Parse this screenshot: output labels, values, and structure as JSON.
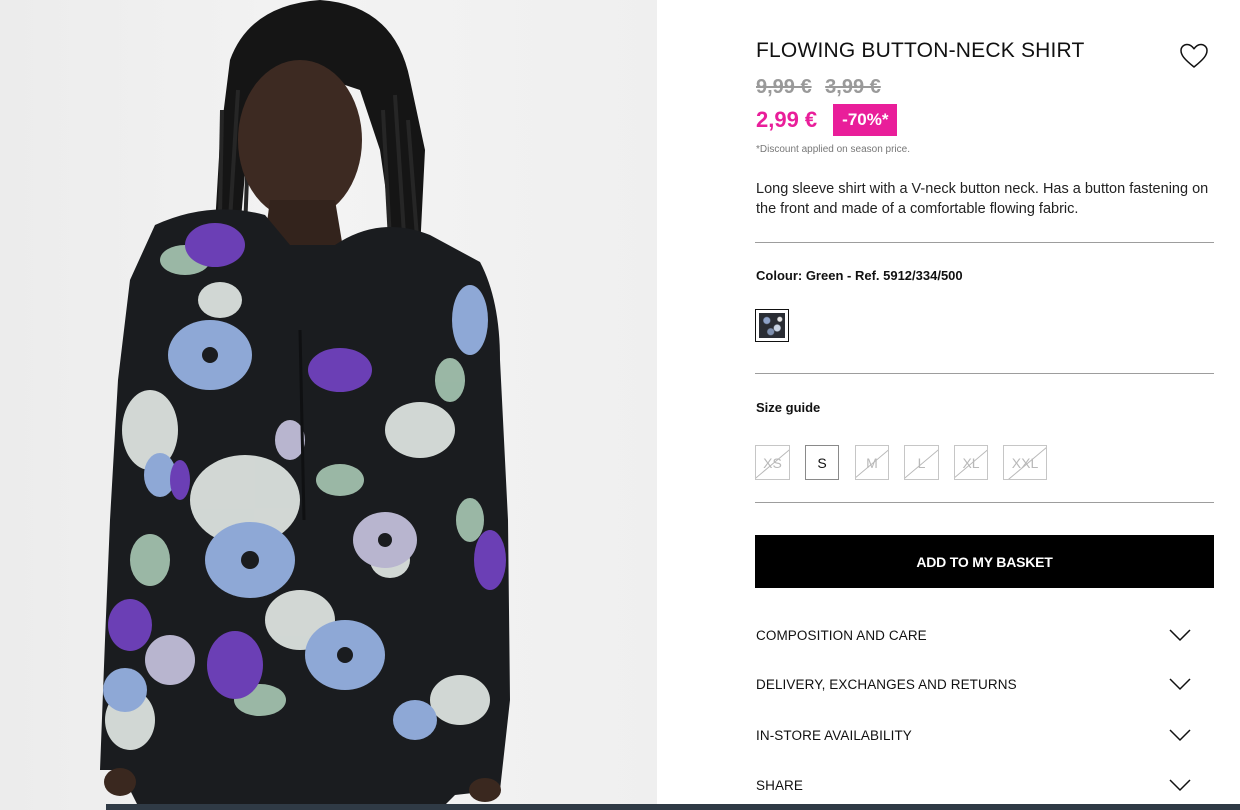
{
  "product": {
    "title": "FLOWING BUTTON-NECK SHIRT",
    "old_prices": [
      "9,99 €",
      "3,99 €"
    ],
    "current_price": "2,99 €",
    "discount_badge": "-70%*",
    "discount_note": "*Discount applied on season price.",
    "description": "Long sleeve shirt with a V-neck button neck. Has a button fastening on the front and made of a comfortable flowing fabric.",
    "colour_label": "Colour: Green - Ref. 5912/334/500",
    "size_guide_label": "Size guide",
    "sizes": [
      {
        "label": "XS",
        "available": false
      },
      {
        "label": "S",
        "available": true
      },
      {
        "label": "M",
        "available": false
      },
      {
        "label": "L",
        "available": false
      },
      {
        "label": "XL",
        "available": false
      },
      {
        "label": "XXL",
        "available": false
      }
    ],
    "add_to_basket_label": "ADD TO MY BASKET",
    "accordion": [
      {
        "label": "COMPOSITION AND CARE"
      },
      {
        "label": "DELIVERY, EXCHANGES AND RETURNS"
      },
      {
        "label": "IN-STORE AVAILABILITY"
      },
      {
        "label": "SHARE"
      }
    ]
  },
  "colors": {
    "accent": "#e91e9a",
    "button_bg": "#000000",
    "muted_price": "#9a9a9a"
  },
  "icons": {
    "wishlist": "heart-icon",
    "accordion": "chevron-down-icon"
  }
}
